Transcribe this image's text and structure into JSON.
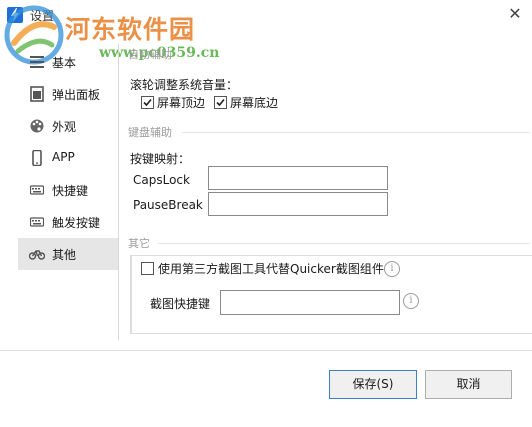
{
  "window": {
    "title": "设置",
    "close_glyph": "✕",
    "app_icon": "lightning-icon"
  },
  "watermark": {
    "title": "河东软件园",
    "url": "www.pc0359.cn"
  },
  "sidebar": {
    "items": [
      {
        "label": "基本",
        "icon": "list-icon"
      },
      {
        "label": "弹出面板",
        "icon": "popup-panel-icon"
      },
      {
        "label": "外观",
        "icon": "palette-icon"
      },
      {
        "label": "APP",
        "icon": "phone-icon"
      },
      {
        "label": "快捷键",
        "icon": "keyboard-icon"
      },
      {
        "label": "触发按键",
        "icon": "keyboard-icon"
      },
      {
        "label": "其他",
        "icon": "bicycle-icon",
        "selected": true
      }
    ]
  },
  "section_auto": {
    "title": "自动辅助",
    "volume_label": "滚轮调整系统音量：",
    "top_edge": {
      "label": "屏幕顶边",
      "checked": true
    },
    "bottom_edge": {
      "label": "屏幕底边",
      "checked": true
    }
  },
  "section_keyboard": {
    "title": "键盘辅助",
    "mapping_label": "按键映射：",
    "capslock": {
      "label": "CapsLock",
      "value": ""
    },
    "pausebreak": {
      "label": "PauseBreak",
      "value": ""
    }
  },
  "section_other": {
    "title": "其它",
    "screenshot_option": {
      "label": "使用第三方截图工具代替Quicker截图组件",
      "checked": false
    },
    "screenshot_hotkey": {
      "label": "截图快捷键",
      "value": ""
    },
    "info_glyph": "i"
  },
  "buttons": {
    "save": "保存(S)",
    "cancel": "取消"
  },
  "colors": {
    "accent": "#3c7fd1",
    "watermark_orange": "#e9822e",
    "watermark_green": "#56b042"
  }
}
